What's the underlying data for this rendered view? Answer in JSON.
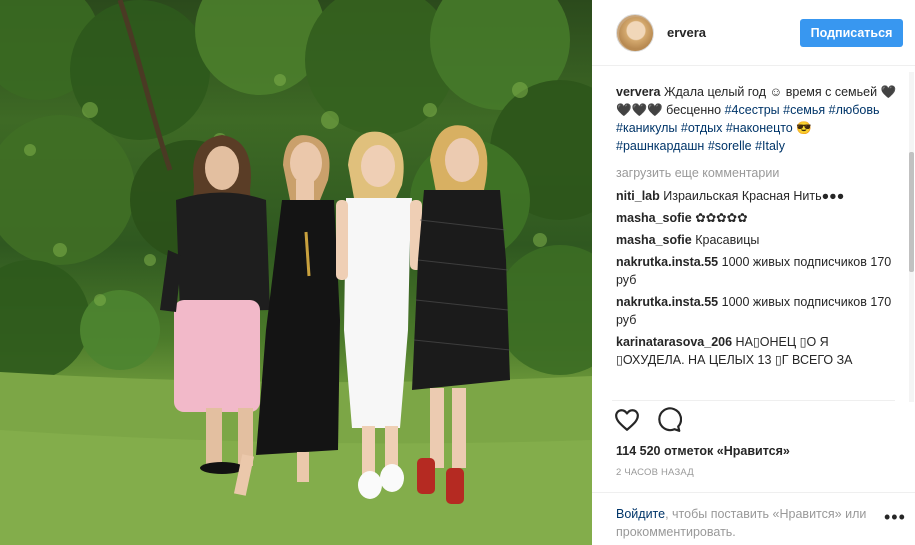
{
  "post": {
    "username": "ervera",
    "follow_label": "Подписаться",
    "caption": {
      "user": "ververa",
      "text_1": " Ждала целый год ☺ время с семьей ",
      "hearts": "🖤🖤🖤🖤",
      "text_2": " бесценно  ",
      "tags": [
        "#4сестры",
        "#семья",
        "#любовь",
        "#каникулы",
        "#отдых",
        "#наконецто"
      ],
      "emoji": " 😎 ",
      "tags_2": [
        "#рашнкардашн",
        "#sorelle",
        "#Italy"
      ]
    },
    "load_more_label": "загрузить еще комментарии",
    "comments": [
      {
        "user": "niti_lab",
        "text": "Израильская Красная Нить●●●"
      },
      {
        "user": "masha_sofie",
        "text": "✿✿✿✿✿"
      },
      {
        "user": "masha_sofie",
        "text": "Красавицы"
      },
      {
        "user": "nakrutka.insta.55",
        "text": "1000 живых подписчиков 170 руб"
      },
      {
        "user": "nakrutka.insta.55",
        "text": "1000 живых подписчиков 170 руб"
      },
      {
        "user": "karinatarasova_206",
        "text": "НА▯ОНЕЦ ▯О Я ▯ОХУДЕЛА. НА ЦЕЛЫХ 13 ▯Г ВСЕГО ЗА"
      }
    ],
    "likes": "114 520 отметок «Нравится»",
    "time_ago": "2 ЧАСОВ НАЗАД",
    "login_link": "Войдите",
    "login_text": ", чтобы поставить «Нравится» или прокомментировать.",
    "more_icon": "•••"
  },
  "colors": {
    "accent": "#3897f0",
    "link": "#003569",
    "muted": "#999999"
  },
  "icons": [
    "heart-icon",
    "comment-icon",
    "more-options-icon"
  ]
}
